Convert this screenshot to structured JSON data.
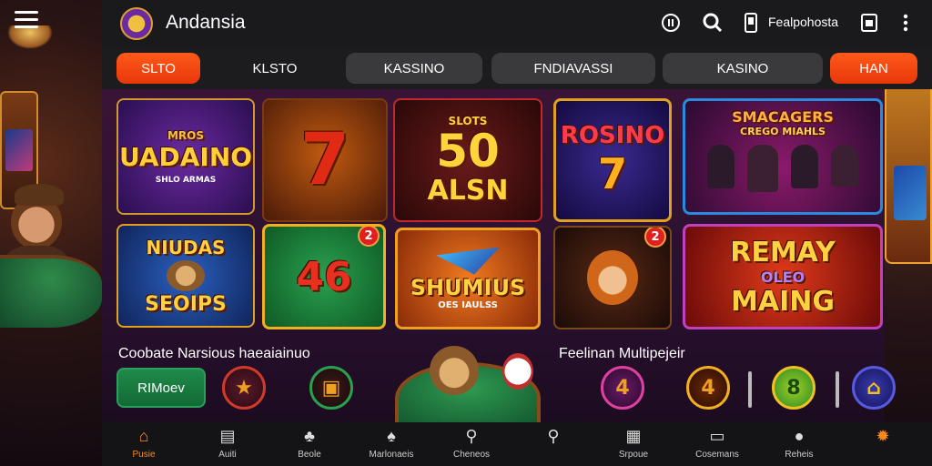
{
  "app": {
    "title": "Andansia"
  },
  "header": {
    "menu_icon": "hamburger-icon",
    "logo_icon": "casino-logo",
    "icons": [
      "info-icon",
      "search-icon",
      "mobile-icon"
    ],
    "account_label": "Fealpohosta",
    "wallet_icon": "wallet-icon",
    "more_icon": "more-vertical-icon"
  },
  "tabs": [
    {
      "label": "SLTO",
      "active": true
    },
    {
      "label": "KLSTO",
      "active": false
    },
    {
      "label": "KASSINO",
      "active": false
    },
    {
      "label": "FNDIAVASSI",
      "active": false
    },
    {
      "label": "KASINO",
      "active": false
    },
    {
      "label": "HAN",
      "active": true
    }
  ],
  "games": [
    {
      "title": "UADAINO",
      "subtitle": "MROS",
      "caption": "SHLO ARMAS"
    },
    {
      "title": "7"
    },
    {
      "title": "50",
      "subtitle": "SLOTS",
      "caption": "ALSN"
    },
    {
      "title": "ROSINO",
      "subtitle": "7"
    },
    {
      "title": "SMACAGERS",
      "subtitle": "CREGO MIAHLS"
    },
    {
      "title": "NIUDAS",
      "caption": "SEOIPS"
    },
    {
      "title": "46",
      "badge": "2"
    },
    {
      "title": "SHUMIUS",
      "caption": "OES IAULSS"
    },
    {
      "title": "",
      "badge": "2"
    },
    {
      "title": "REMAY",
      "subtitle": "OLEO",
      "caption": "MAING"
    }
  ],
  "sections": {
    "left_title": "Coobate Narsious haeaiainuo",
    "right_title": "Feelinan Multipejeir",
    "left_button": "RIMoev"
  },
  "quick_chips": [
    {
      "icon": "star-icon"
    },
    {
      "icon": "chest-icon"
    },
    {
      "value": "4"
    },
    {
      "value": "4"
    },
    {
      "value": "8"
    },
    {
      "icon": "sofa-icon"
    }
  ],
  "bottom_nav": [
    {
      "icon": "home-icon",
      "label": "Pusie",
      "active": true
    },
    {
      "icon": "document-icon",
      "label": "Auiti"
    },
    {
      "icon": "club-icon",
      "label": "Beole"
    },
    {
      "icon": "flame-icon",
      "label": "Marlonaeis"
    },
    {
      "icon": "search-icon",
      "label": "Cheneos"
    },
    {
      "icon": "search-icon",
      "label": ""
    },
    {
      "icon": "list-icon",
      "label": "Srpoue"
    },
    {
      "icon": "basket-icon",
      "label": "Cosemans"
    },
    {
      "icon": "user-icon",
      "label": "Reheis"
    },
    {
      "icon": "gear-icon",
      "label": ""
    }
  ],
  "colors": {
    "accent": "#ff5a1a",
    "nav_active": "#ff8a1a",
    "tab_bg": "#3a3a3c",
    "bg": "#1a1a1c"
  }
}
